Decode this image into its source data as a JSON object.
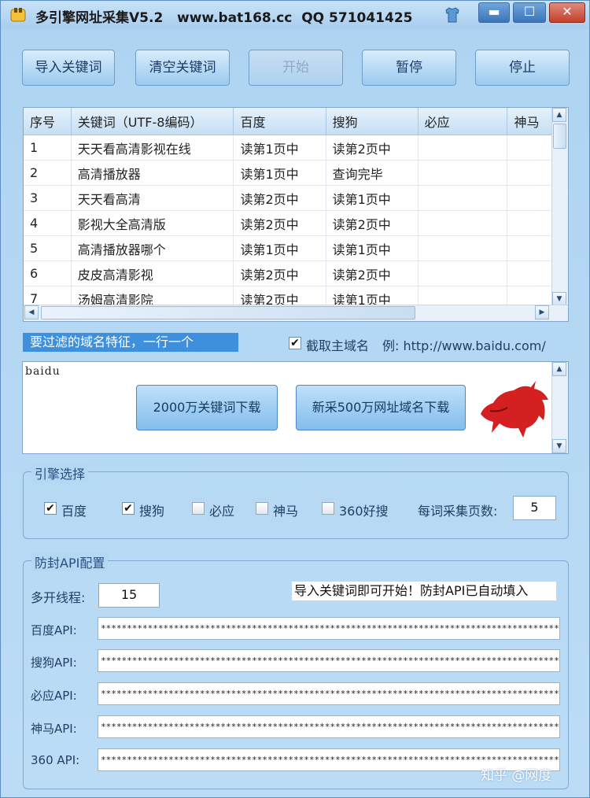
{
  "window": {
    "title": "多引擎网址采集V5.2   www.bat168.cc  QQ 571041425",
    "min_symbol": "▬",
    "max_symbol": "☐",
    "close_symbol": "✕"
  },
  "toolbar": {
    "import_label": "导入关键词",
    "clear_label": "清空关键词",
    "start_label": "开始",
    "pause_label": "暂停",
    "stop_label": "停止"
  },
  "grid": {
    "columns": [
      "序号",
      "关键词（UTF-8编码）",
      "百度",
      "搜狗",
      "必应",
      "神马"
    ],
    "rows": [
      [
        "1",
        "天天看高清影视在线",
        "读第1页中",
        "读第2页中",
        "",
        ""
      ],
      [
        "2",
        "高清播放器",
        "读第1页中",
        "查询完毕",
        "",
        ""
      ],
      [
        "3",
        "天天看高清",
        "读第2页中",
        "读第1页中",
        "",
        ""
      ],
      [
        "4",
        "影视大全高清版",
        "读第2页中",
        "读第2页中",
        "",
        ""
      ],
      [
        "5",
        "高清播放器哪个",
        "读第1页中",
        "读第1页中",
        "",
        ""
      ],
      [
        "6",
        "皮皮高清影视",
        "读第2页中",
        "读第2页中",
        "",
        ""
      ],
      [
        "7",
        "汤姆高清影院",
        "读第2页中",
        "读第1页中",
        "",
        ""
      ]
    ]
  },
  "filter": {
    "label": "要过滤的域名特征，一行一个",
    "extract_main_domain_label": "截取主域名",
    "example_label": "例: http://www.baidu.com/",
    "extract_checked": true,
    "textarea_value": "baidu",
    "download_keywords_label": "2000万关键词下载",
    "download_domains_label": "新采500万网址域名下载"
  },
  "engines": {
    "group_title": "引擎选择",
    "options": [
      {
        "label": "百度",
        "checked": true
      },
      {
        "label": "搜狗",
        "checked": true
      },
      {
        "label": "必应",
        "checked": false
      },
      {
        "label": "神马",
        "checked": false
      },
      {
        "label": "360好搜",
        "checked": false
      }
    ],
    "pages_label": "每词采集页数:",
    "pages_value": "5"
  },
  "api": {
    "group_title": "防封API配置",
    "threads_label": "多开线程:",
    "threads_value": "15",
    "note": "导入关键词即可开始！防封API已自动填入",
    "masked_value": "************************************************************************************************",
    "fields": [
      {
        "label": "百度API:"
      },
      {
        "label": "搜狗API:"
      },
      {
        "label": "必应API:"
      },
      {
        "label": "神马API:"
      },
      {
        "label": "360 API:"
      }
    ]
  },
  "watermark": "知乎 @网度",
  "colors": {
    "window_bg": "#b4d7f4",
    "filter_label_bg": "#3e8fdc",
    "close_button": "#c2402c",
    "bull_red": "#d42020"
  },
  "icons": [
    "app-icon",
    "shirt-icon",
    "check-icon",
    "bull-logo"
  ]
}
